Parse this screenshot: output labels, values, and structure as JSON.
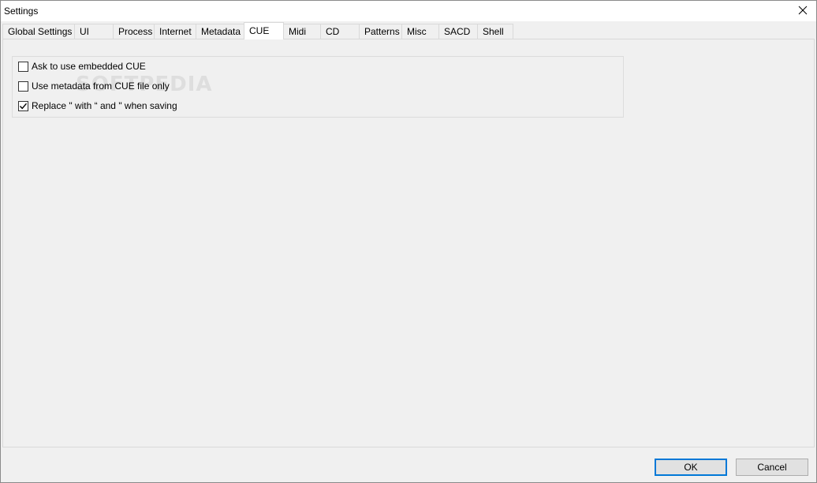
{
  "window": {
    "title": "Settings"
  },
  "tabs": [
    {
      "label": "Global Settings",
      "selected": false
    },
    {
      "label": "UI",
      "selected": false
    },
    {
      "label": "Process",
      "selected": false
    },
    {
      "label": "Internet",
      "selected": false
    },
    {
      "label": "Metadata",
      "selected": false
    },
    {
      "label": "CUE",
      "selected": true
    },
    {
      "label": "Midi",
      "selected": false
    },
    {
      "label": "CD",
      "selected": false
    },
    {
      "label": "Patterns",
      "selected": false
    },
    {
      "label": "Misc",
      "selected": false
    },
    {
      "label": "SACD",
      "selected": false
    },
    {
      "label": "Shell",
      "selected": false
    }
  ],
  "cue_options": [
    {
      "label": "Ask to use embedded CUE",
      "checked": false
    },
    {
      "label": "Use metadata from CUE file only",
      "checked": false
    },
    {
      "label": "Replace \" with “ and \" when saving",
      "checked": true
    }
  ],
  "watermark": "SOFTPEDIA",
  "buttons": {
    "ok": "OK",
    "cancel": "Cancel"
  },
  "icons": {
    "close": "close-icon",
    "check": "checkmark-icon"
  }
}
